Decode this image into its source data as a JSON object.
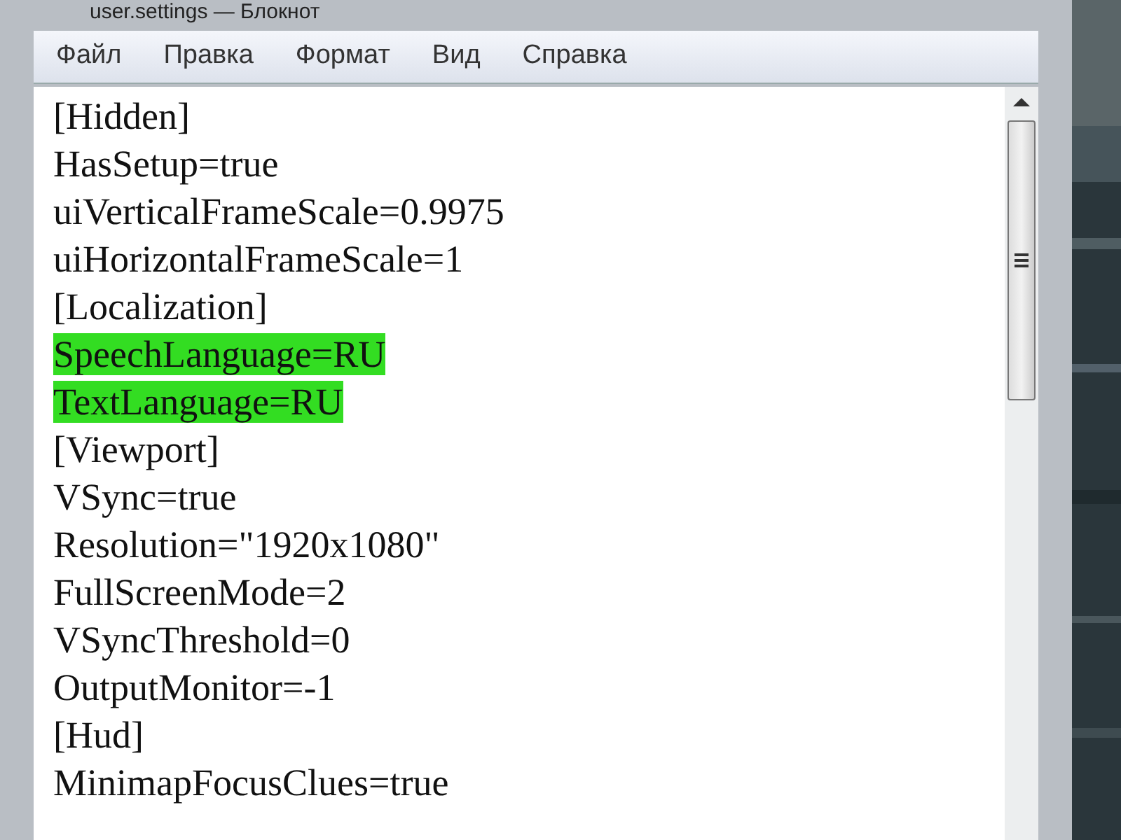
{
  "window": {
    "title": "user.settings — Блокнот"
  },
  "menu": [
    "Файл",
    "Правка",
    "Формат",
    "Вид",
    "Справка"
  ],
  "lines": [
    {
      "text": "[Hidden]",
      "highlighted": false
    },
    {
      "text": "HasSetup=true",
      "highlighted": false
    },
    {
      "text": "uiVerticalFrameScale=0.9975",
      "highlighted": false
    },
    {
      "text": "uiHorizontalFrameScale=1",
      "highlighted": false
    },
    {
      "text": "[Localization]",
      "highlighted": false
    },
    {
      "text": "SpeechLanguage=RU",
      "highlighted": true
    },
    {
      "text": "TextLanguage=RU",
      "highlighted": true
    },
    {
      "text": "[Viewport]",
      "highlighted": false
    },
    {
      "text": "VSync=true",
      "highlighted": false
    },
    {
      "text": "Resolution=\"1920x1080\"",
      "highlighted": false
    },
    {
      "text": "FullScreenMode=2",
      "highlighted": false
    },
    {
      "text": "VSyncThreshold=0",
      "highlighted": false
    },
    {
      "text": "OutputMonitor=-1",
      "highlighted": false
    },
    {
      "text": "[Hud]",
      "highlighted": false
    },
    {
      "text": "MinimapFocusClues=true",
      "highlighted": false
    }
  ]
}
